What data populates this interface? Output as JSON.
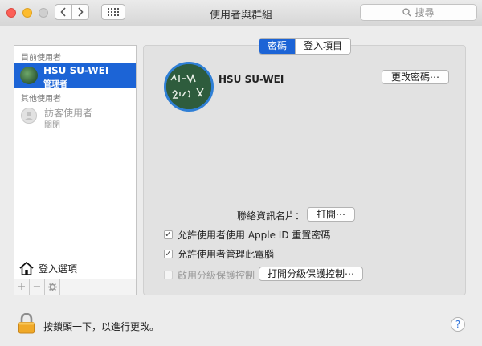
{
  "window": {
    "title": "使用者與群組",
    "search_placeholder": "搜尋"
  },
  "sidebar": {
    "current_users_heading": "目前使用者",
    "current_user": {
      "name": "HSU SU-WEI",
      "role": "管理者"
    },
    "other_users_heading": "其他使用者",
    "guest_user": {
      "name": "訪客使用者",
      "status": "關閉"
    },
    "login_options_label": "登入選項",
    "toolbar": {
      "add": "+",
      "remove": "−"
    }
  },
  "tabs": [
    {
      "label": "密碼",
      "active": true
    },
    {
      "label": "登入項目",
      "active": false
    }
  ],
  "main": {
    "username": "HSU SU-WEI",
    "change_password_button": "更改密碼⋯",
    "contact_card_label": "聯絡資訊名片：",
    "open_button": "打開⋯",
    "checkboxes": [
      {
        "label": "允許使用者使用 Apple ID 重置密碼",
        "checked": true,
        "enabled": true
      },
      {
        "label": "允許使用者管理此電腦",
        "checked": true,
        "enabled": true
      },
      {
        "label": "啟用分級保護控制",
        "checked": false,
        "enabled": false
      }
    ],
    "parental_controls_button": "打開分級保護控制⋯"
  },
  "footer": {
    "lock_text": "按鎖頭一下，以進行更改。",
    "help_label": "?"
  },
  "colors": {
    "accent": "#1c64d6",
    "lock_body": "#f0a928"
  }
}
